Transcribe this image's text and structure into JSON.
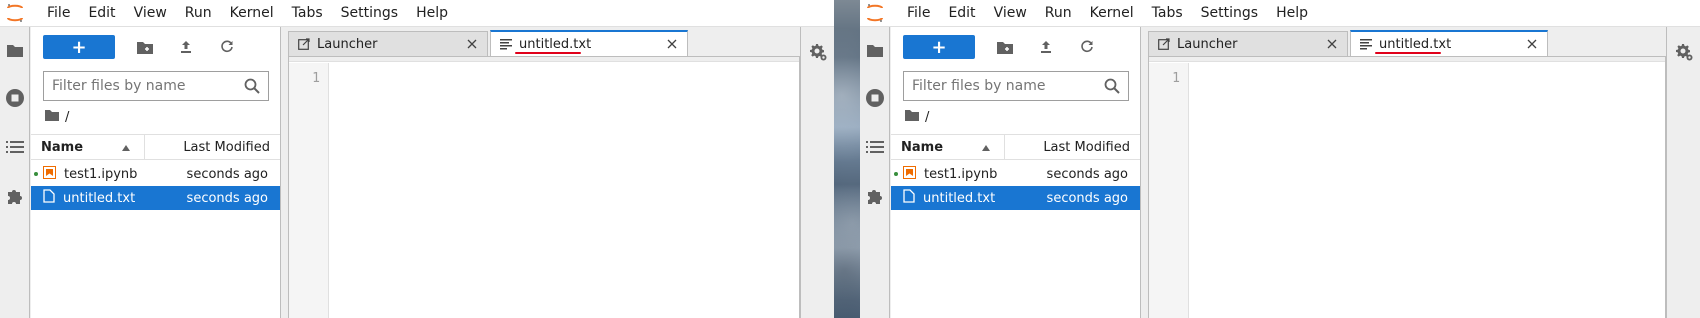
{
  "menu": {
    "items": [
      "File",
      "Edit",
      "View",
      "Run",
      "Kernel",
      "Tabs",
      "Settings",
      "Help"
    ]
  },
  "filebrowser": {
    "new_label": "+",
    "filter_placeholder": "Filter files by name",
    "breadcrumb": "/",
    "columns": {
      "name": "Name",
      "modified": "Last Modified"
    },
    "files": [
      {
        "name": "test1.ipynb",
        "modified": "seconds ago",
        "type": "notebook",
        "running": true,
        "selected": false
      },
      {
        "name": "untitled.txt",
        "modified": "seconds ago",
        "type": "text",
        "running": false,
        "selected": true
      }
    ]
  },
  "tabs": [
    {
      "label": "Launcher",
      "icon": "launcher-icon",
      "active": false
    },
    {
      "label": "untitled.txt",
      "icon": "text-file-icon",
      "active": true
    }
  ],
  "editor": {
    "line_number": "1"
  },
  "colors": {
    "accent": "#1976d2",
    "underline": "#e0001a",
    "running_dot": "#388e3c",
    "notebook_icon": "#ef6c00"
  }
}
